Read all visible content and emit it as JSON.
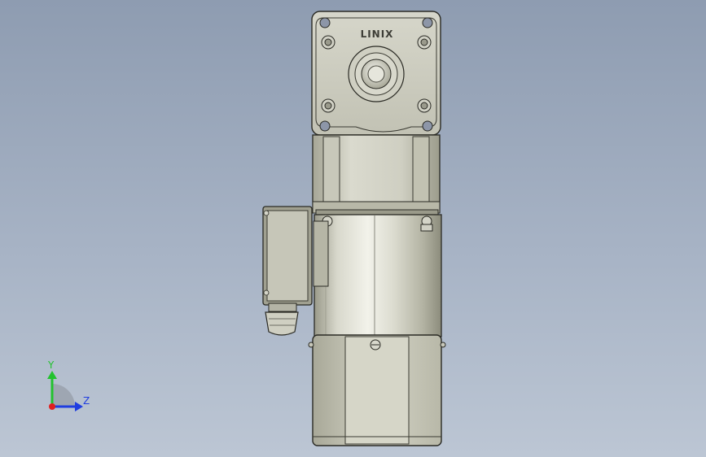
{
  "viewport": {
    "model_brand": "LINIX"
  },
  "triad": {
    "y_label": "Y",
    "z_label": "Z",
    "y_color": "#22c22e",
    "z_color": "#1f3de0",
    "x_color": "#e02020"
  },
  "colors": {
    "background_top": "#8e9cb1",
    "background_bottom": "#bcc6d4",
    "body_light": "#e2e2d6",
    "body_mid": "#c4c4b4",
    "body_dark": "#8a8a7c",
    "edge": "#2a2a24"
  }
}
